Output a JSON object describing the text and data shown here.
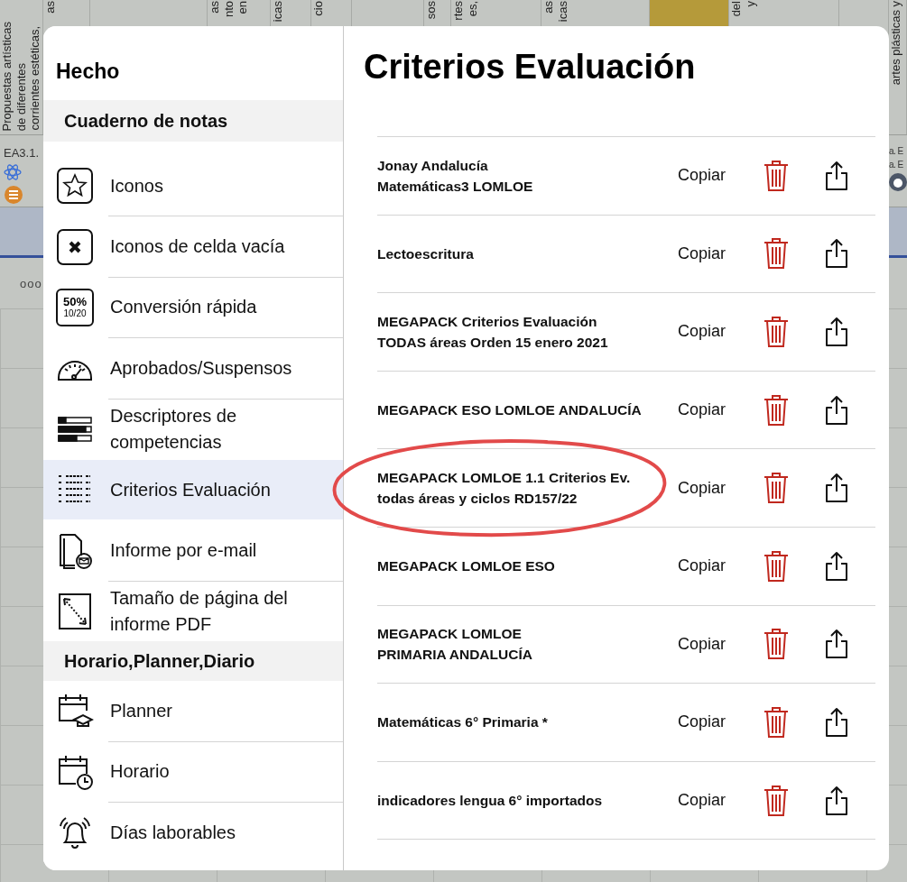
{
  "background": {
    "header_columns": [
      {
        "lines": [
          "Propuestas artísticas",
          "de diferentes",
          "corrientes estéticas,"
        ]
      },
      {
        "lines": [
          "as"
        ]
      },
      {},
      {
        "lines": [
          "as",
          "nto",
          "en"
        ]
      },
      {
        "lines": [
          "icas"
        ]
      },
      {
        "lines": [
          "cio"
        ]
      },
      {},
      {
        "lines": [
          "sos"
        ]
      },
      {
        "lines": [
          "rtes",
          "es,"
        ]
      },
      {
        "lines": [
          "as",
          "icas"
        ]
      },
      {
        "highlighted": true
      },
      {
        "lines": [
          "del",
          "y"
        ]
      },
      {},
      {
        "lines": [
          "artes plásticas y"
        ]
      }
    ],
    "left_code": "EA3.1.",
    "right_codes": [
      "a. E",
      "a. E"
    ],
    "dots": "ooo"
  },
  "sidebar": {
    "done": "Hecho",
    "sections": [
      {
        "title": "Cuaderno de notas",
        "items": [
          {
            "kind": "star",
            "label": "Iconos",
            "selected": false
          },
          {
            "kind": "cross",
            "label": "Iconos de celda vacía",
            "selected": false
          },
          {
            "kind": "percent",
            "label": "Conversión rápida",
            "badge": [
              "50%",
              "10/20"
            ],
            "selected": false
          },
          {
            "kind": "gauge",
            "label": "Aprobados/Suspensos",
            "selected": false
          },
          {
            "kind": "bars",
            "label": "Descriptores de competencias",
            "selected": false
          },
          {
            "kind": "list",
            "label": "Criterios Evaluación",
            "selected": true
          },
          {
            "kind": "mail",
            "label": "Informe por e-mail",
            "selected": false
          },
          {
            "kind": "resize",
            "label": "Tamaño de página del informe PDF",
            "selected": false
          }
        ]
      },
      {
        "title": "Horario,Planner,Diario",
        "items": [
          {
            "kind": "planner",
            "label": "Planner",
            "selected": false
          },
          {
            "kind": "clock",
            "label": "Horario",
            "selected": false
          },
          {
            "kind": "bell",
            "label": "Días laborables",
            "selected": false
          }
        ]
      }
    ]
  },
  "detail": {
    "title": "Criterios Evaluación",
    "rows": [
      {
        "lines": [
          "Jonay Andalucía",
          "Matemáticas3 LOMLOE"
        ],
        "copy": "Copiar"
      },
      {
        "lines": [
          "Lectoescritura"
        ],
        "copy": "Copiar"
      },
      {
        "lines": [
          "MEGAPACK Criterios Evaluación",
          "TODAS áreas Orden 15 enero 2021"
        ],
        "copy": "Copiar"
      },
      {
        "lines": [
          "MEGAPACK ESO LOMLOE ANDALUCÍA"
        ],
        "copy": "Copiar"
      },
      {
        "lines": [
          "MEGAPACK LOMLOE 1.1 Criterios Ev.",
          "todas áreas y ciclos RD157/22"
        ],
        "copy": "Copiar",
        "circled": true
      },
      {
        "lines": [
          "MEGAPACK LOMLOE ESO"
        ],
        "copy": "Copiar"
      },
      {
        "lines": [
          "MEGAPACK LOMLOE",
          "PRIMARIA ANDALUCÍA"
        ],
        "copy": "Copiar"
      },
      {
        "lines": [
          "Matemáticas 6° Primaria *"
        ],
        "copy": "Copiar"
      },
      {
        "lines": [
          "indicadores lengua 6° importados"
        ],
        "copy": "Copiar"
      }
    ]
  }
}
